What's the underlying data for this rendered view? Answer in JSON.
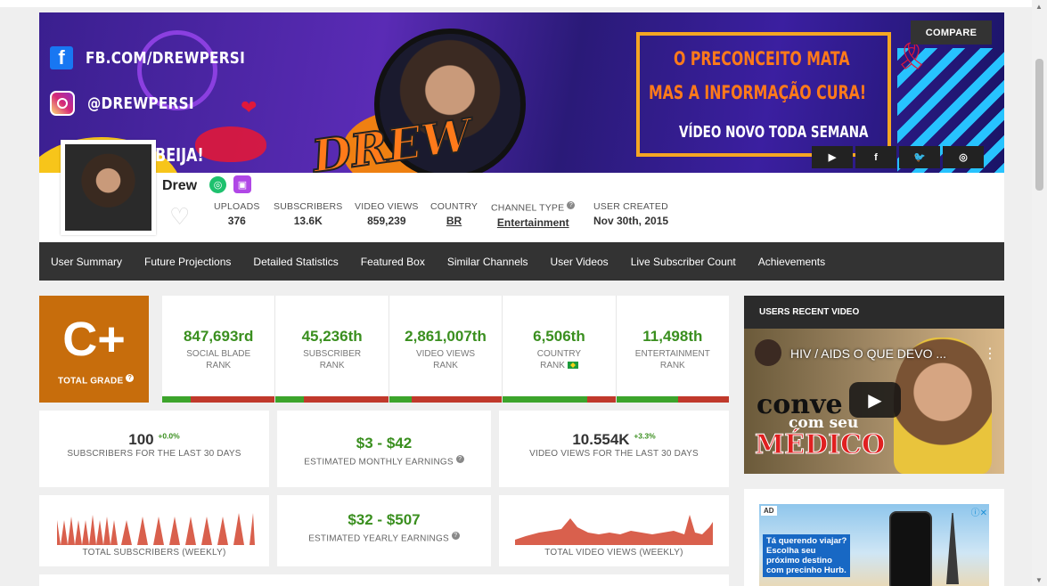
{
  "banner": {
    "fb_text": "FB.COM/DREWPERSI",
    "ig_text": "@DREWPERSI",
    "beija": "BEIJA!",
    "drew_art": "DREW",
    "message_line1": "O PRECONCEITO MATA",
    "message_line2": "MAS A INFORMAÇÃO CURA!",
    "message_line3": "VÍDEO NOVO TODA SEMANA",
    "compare_label": "COMPARE",
    "social_icons": [
      "youtube-icon",
      "facebook-icon",
      "twitter-icon",
      "instagram-icon"
    ],
    "social_glyphs": [
      "▶",
      "f",
      "🐦",
      "◎"
    ]
  },
  "profile": {
    "name": "Drew",
    "stats": {
      "uploads": {
        "label": "UPLOADS",
        "value": "376"
      },
      "subscribers": {
        "label": "SUBSCRIBERS",
        "value": "13.6K"
      },
      "video_views": {
        "label": "VIDEO VIEWS",
        "value": "859,239"
      },
      "country": {
        "label": "COUNTRY",
        "value": "BR"
      },
      "channel_type": {
        "label": "CHANNEL TYPE",
        "value": "Entertainment"
      },
      "user_created": {
        "label": "USER CREATED",
        "value": "Nov 30th, 2015"
      }
    }
  },
  "nav": {
    "items": [
      "User Summary",
      "Future Projections",
      "Detailed Statistics",
      "Featured Box",
      "Similar Channels",
      "User Videos",
      "Live Subscriber Count",
      "Achievements"
    ]
  },
  "grade": {
    "letter": "C+",
    "label": "TOTAL GRADE"
  },
  "ranks": [
    {
      "value": "847,693rd",
      "label": "SOCIAL BLADE\nRANK",
      "fill": 0.25
    },
    {
      "value": "45,236th",
      "label": "SUBSCRIBER\nRANK",
      "fill": 0.25
    },
    {
      "value": "2,861,007th",
      "label": "VIDEO VIEWS\nRANK",
      "fill": 0.2
    },
    {
      "value": "6,506th",
      "label": "COUNTRY\nRANK",
      "fill": 0.75
    },
    {
      "value": "11,498th",
      "label": "ENTERTAINMENT\nRANK",
      "fill": 0.55
    }
  ],
  "cards": {
    "subs30": {
      "value": "100",
      "change": "+0.0%",
      "label": "SUBSCRIBERS FOR THE LAST 30 DAYS"
    },
    "monthly": {
      "value": "$3  -  $42",
      "label": "ESTIMATED MONTHLY EARNINGS"
    },
    "views30": {
      "value": "10.554K",
      "change": "+3.3%",
      "label": "VIDEO VIEWS FOR THE LAST 30 DAYS"
    },
    "weekly_subs": {
      "label": "TOTAL SUBSCRIBERS (WEEKLY)"
    },
    "yearly": {
      "value": "$32  -  $507",
      "label": "ESTIMATED YEARLY EARNINGS"
    },
    "weekly_views": {
      "label": "TOTAL VIDEO VIEWS (WEEKLY)"
    }
  },
  "recent_video": {
    "header": "USERS RECENT VIDEO",
    "title": "HIV / AIDS O QUE DEVO ...",
    "thumb_word1": "conve",
    "thumb_word2": "com seu",
    "thumb_word3": "MÉDICO"
  },
  "ad": {
    "tag": "AD",
    "close": "ⓘ✕",
    "promo": "Tá querendo viajar?\nEscolha seu\npróximo destino\ncom precinho Hurb."
  },
  "colors": {
    "grade_bg": "#c76d0c",
    "rank_green": "#3a8f1f",
    "bar_red": "#c0392b",
    "bar_green": "#3ca42b",
    "nav_bg": "#333333",
    "sparkline": "#d9604d"
  }
}
